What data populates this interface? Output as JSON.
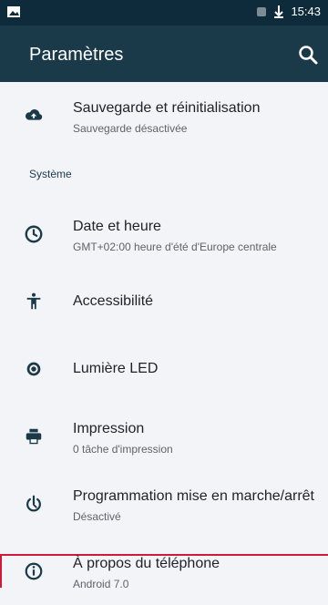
{
  "status": {
    "time": "15:43"
  },
  "appbar": {
    "title": "Paramètres"
  },
  "section": {
    "system": "Système"
  },
  "items": [
    {
      "title": "Sauvegarde et réinitialisation",
      "subtitle": "Sauvegarde désactivée"
    },
    {
      "title": "Date et heure",
      "subtitle": "GMT+02:00 heure d'été d'Europe centrale"
    },
    {
      "title": "Accessibilité",
      "subtitle": ""
    },
    {
      "title": "Lumière LED",
      "subtitle": ""
    },
    {
      "title": "Impression",
      "subtitle": "0 tâche d'impression"
    },
    {
      "title": "Programmation mise en marche/arrêt",
      "subtitle": "Désactivé"
    },
    {
      "title": "À propos du téléphone",
      "subtitle": "Android 7.0"
    }
  ],
  "icons": {
    "backup": "cloud-upload-icon",
    "date": "clock-icon",
    "accessibility": "accessibility-icon",
    "led": "led-icon",
    "printing": "printer-icon",
    "power_schedule": "power-schedule-icon",
    "about": "info-icon"
  },
  "colors": {
    "status_bar": "#0d2b3a",
    "app_bar": "#1a3a4a",
    "background": "#f3f4f7",
    "icon": "#1a3a4a",
    "highlight": "#d11a3a"
  }
}
